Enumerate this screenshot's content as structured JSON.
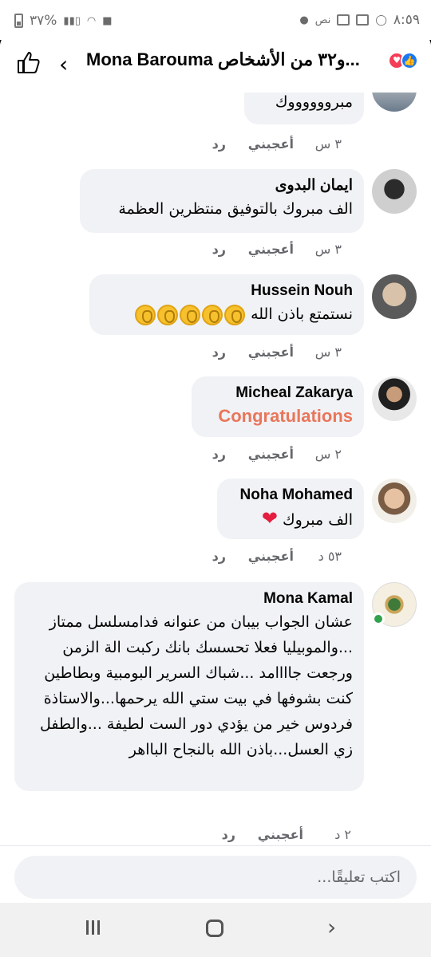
{
  "status_bar": {
    "battery": "٣٧%",
    "time": "٨:٥٩",
    "carrier": "نص"
  },
  "header": {
    "title_name": "Mona Barouma",
    "title_rest": "و٣٢ من الأشخاص..."
  },
  "colors": {
    "accent": "#1877f2",
    "love": "#f33e58",
    "congrats": "#e9765a",
    "bubble": "#f0f2f5"
  },
  "comments": [
    {
      "name": "",
      "text": "مبرووووووك",
      "time": "٣ س",
      "like": "أعجبني",
      "reply": "رد"
    },
    {
      "name": "ايمان البدوى",
      "text": "الف مبروك بالتوفيق منتظرين العظمة",
      "time": "٣ س",
      "like": "أعجبني",
      "reply": "رد"
    },
    {
      "name": "Hussein Nouh",
      "text": "نستمتع باذن الله",
      "time": "٣ س",
      "like": "أعجبني",
      "reply": "رد"
    },
    {
      "name": "Micheal Zakarya",
      "text": "Congratulations",
      "time": "٢ س",
      "like": "أعجبني",
      "reply": "رد"
    },
    {
      "name": "Noha Mohamed",
      "text": "الف مبروك",
      "time": "٥٣ د",
      "like": "أعجبني",
      "reply": "رد"
    },
    {
      "name": "Mona Kamal",
      "text": "عشان الجواب بيبان من عنوانه فدامسلسل ممتاز ...والموبيليا فعلا تحسسك بانك ركبت الة الزمن ورجعت جاااامد ...شباك السرير البومبية وبطاطين كنت بشوفها في بيت ستي الله يرحمها...والاستاذة فردوس خير من يؤدي دور الست لطيفة ...والطفل زي العسل...باذن الله بالنجاح البااهر",
      "time": "٢ د",
      "like": "أعجبني",
      "reply": "رد"
    }
  ],
  "composer": {
    "placeholder": "اكتب تعليقًا..."
  }
}
